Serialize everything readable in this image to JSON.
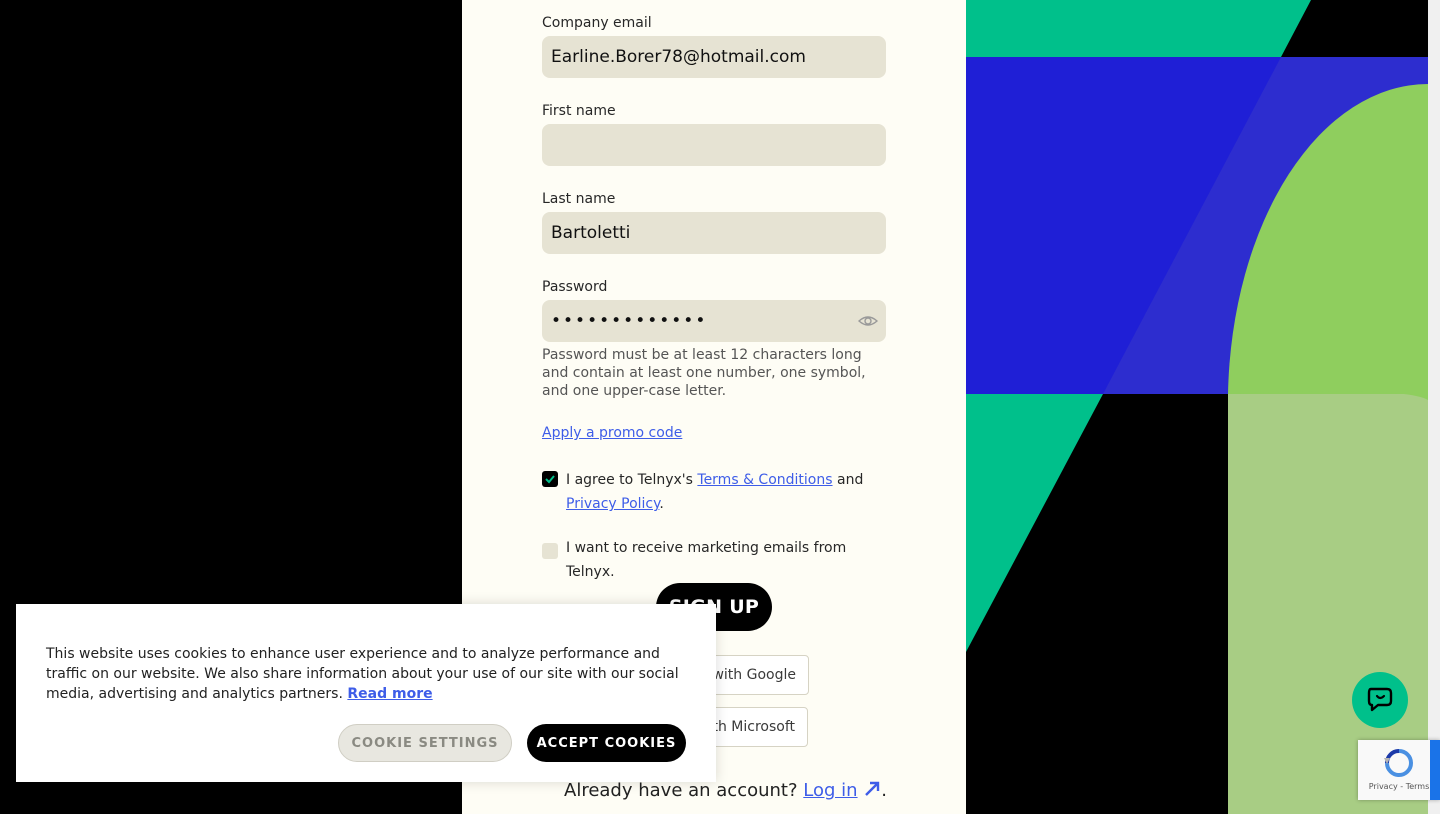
{
  "form": {
    "email_label": "Company email",
    "email_value": "Earline.Borer78@hotmail.com",
    "first_name_label": "First name",
    "first_name_value": "",
    "last_name_label": "Last name",
    "last_name_value": "Bartoletti",
    "password_label": "Password",
    "password_value": "•••••••••••••",
    "password_hint": "Password must be at least 12 characters long and contain at least one number, one symbol, and one upper-case letter.",
    "promo_link": "Apply a promo code",
    "terms_prefix": "I agree to Telnyx's ",
    "terms_link": "Terms & Conditions",
    "terms_and": " and",
    "privacy_link": "Privacy Policy",
    "terms_suffix": ".",
    "marketing_label": "I want to receive marketing emails from Telnyx.",
    "terms_checked": true,
    "marketing_checked": false,
    "signup_button": "SIGN UP",
    "google_button": "with Google",
    "microsoft_button": "with Microsoft",
    "login_prompt": "Already have an account?",
    "login_link": "Log in",
    "login_suffix": "."
  },
  "cookie_banner": {
    "text": "This website uses cookies to enhance user experience and to analyze performance and traffic on our website. We also share information about your use of our site with our social media, advertising and analytics partners.",
    "read_more": "Read more",
    "settings_button": "COOKIE SETTINGS",
    "accept_button": "ACCEPT COOKIES"
  },
  "recaptcha": {
    "links": "Privacy - Terms"
  },
  "colors": {
    "accent_link": "#3e5de8",
    "art_green": "#00c08b",
    "art_blue": "#1f1fd6",
    "art_lime": "#8fce5e",
    "art_pale_lime": "#a8cd84"
  }
}
